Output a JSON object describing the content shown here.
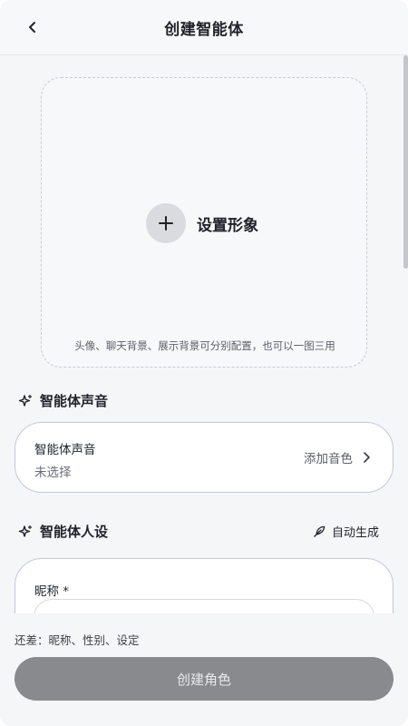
{
  "header": {
    "title": "创建智能体"
  },
  "avatar": {
    "add_label": "设置形象",
    "hint": "头像、聊天背景、展示背景可分别配置，也可以一图三用"
  },
  "voice_section": {
    "title": "智能体声音",
    "card_title": "智能体声音",
    "card_value": "未选择",
    "action_label": "添加音色"
  },
  "persona_section": {
    "title": "智能体人设",
    "auto_generate_label": "自动生成",
    "nickname_label": "昵称 *",
    "nickname_value": ""
  },
  "footer": {
    "missing_text": "还差：昵称、性别、设定",
    "create_label": "创建角色"
  }
}
